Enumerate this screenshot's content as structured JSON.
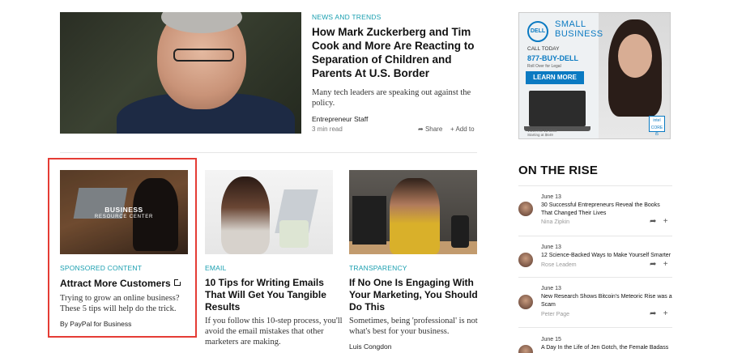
{
  "featured": {
    "category": "NEWS AND TRENDS",
    "title_lines": [
      "How Mark Zuckerberg and Tim",
      "Cook and More Are Reacting to",
      "Separation of Children and",
      "Parents At U.S. Border"
    ],
    "dek_lines": [
      "Many tech leaders are speaking out against the",
      "policy."
    ],
    "author": "Entrepreneur Staff",
    "read_time": "3 min read",
    "share_label": "Share",
    "add_label": "Add to"
  },
  "ad": {
    "logo": "DELL",
    "line1": "SMALL",
    "line2": "BUSINESS",
    "call": "CALL TODAY",
    "phone": "877-BUY-DELL",
    "roll": "Roll Over for Legal",
    "cta": "LEARN MORE",
    "intel_line1": "intel",
    "intel_line2": "CORE i5",
    "fine_line1": "VOSTRO 15 5000",
    "fine_line2": "Starting at $649"
  },
  "cards": [
    {
      "image_line1": "BUSINESS",
      "image_line2": "RESOURCE CENTER",
      "category": "SPONSORED CONTENT",
      "title_lines": [
        "Attract More Customers"
      ],
      "dek_lines": [
        "Trying to grow an online business?",
        "These 5 tips will help do the trick."
      ],
      "author": "By PayPal for Business"
    },
    {
      "category": "EMAIL",
      "title_lines": [
        "10 Tips for Writing Emails",
        "That Will Get You Tangible",
        "Results"
      ],
      "dek_lines": [
        "If you follow this 10-step process, you'll",
        "avoid the email mistakes that other",
        "marketers are making."
      ],
      "author": ""
    },
    {
      "category": "TRANSPARENCY",
      "title_lines": [
        "If No One Is Engaging With",
        "Your Marketing, You Should",
        "Do This"
      ],
      "dek_lines": [
        "Sometimes, being 'professional' is not",
        "what's best for your business."
      ],
      "author": "Luis Congdon"
    }
  ],
  "rise": {
    "title": "ON THE RISE",
    "items": [
      {
        "date": "June 13",
        "title_lines": [
          "30 Successful Entrepreneurs Reveal the Books",
          "That Changed Their Lives"
        ],
        "author": "Nina Zipkin"
      },
      {
        "date": "June 13",
        "title_lines": [
          "12 Science-Backed Ways to Make Yourself Smarter"
        ],
        "author": "Rose Leadem"
      },
      {
        "date": "June 13",
        "title_lines": [
          "New Research Shows Bitcoin's Meteoric Rise was a",
          "Scam"
        ],
        "author": "Peter Page"
      },
      {
        "date": "June 15",
        "title_lines": [
          "A Day In the Life of Jen Gotch, the Female Badass"
        ],
        "author": ""
      }
    ]
  }
}
